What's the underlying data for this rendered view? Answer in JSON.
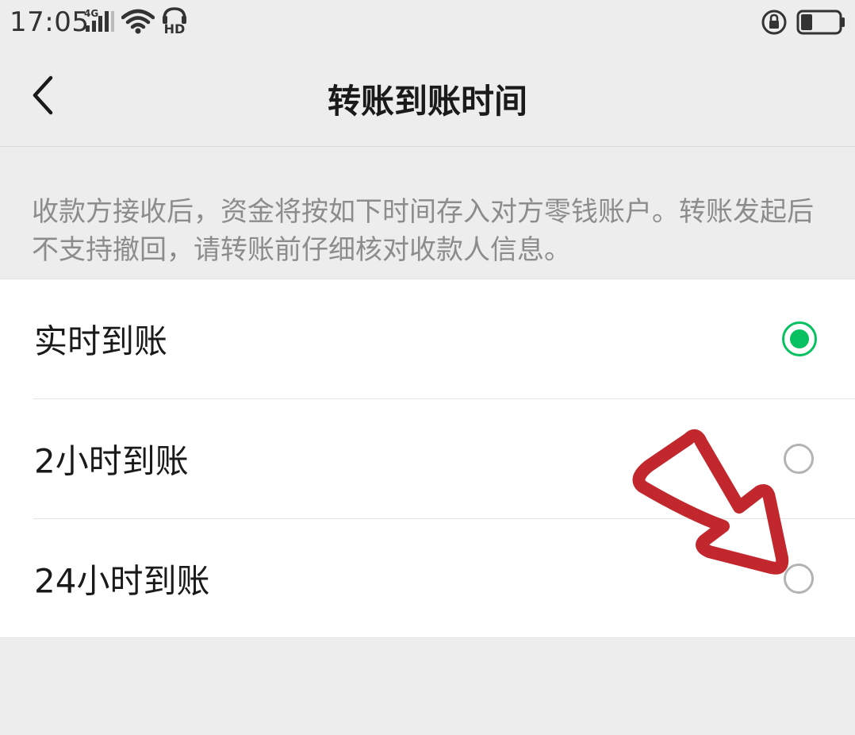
{
  "status_bar": {
    "time": "17:05",
    "network": "4G",
    "icons": [
      "signal-4g-icon",
      "wifi-icon",
      "hd-icon",
      "rotation-lock-icon",
      "battery-icon"
    ]
  },
  "nav": {
    "back_icon": "chevron-left-icon",
    "title": "转账到账时间"
  },
  "description": "收款方接收后，资金将按如下时间存入对方零钱账户。转账发起后不支持撤回，请转账前仔细核对收款人信息。",
  "options": [
    {
      "label": "实时到账",
      "selected": true
    },
    {
      "label": "2小时到账",
      "selected": false
    },
    {
      "label": "24小时到账",
      "selected": false
    }
  ],
  "colors": {
    "accent": "#07c160",
    "background": "#ededed",
    "annotation": "#c1272d"
  }
}
